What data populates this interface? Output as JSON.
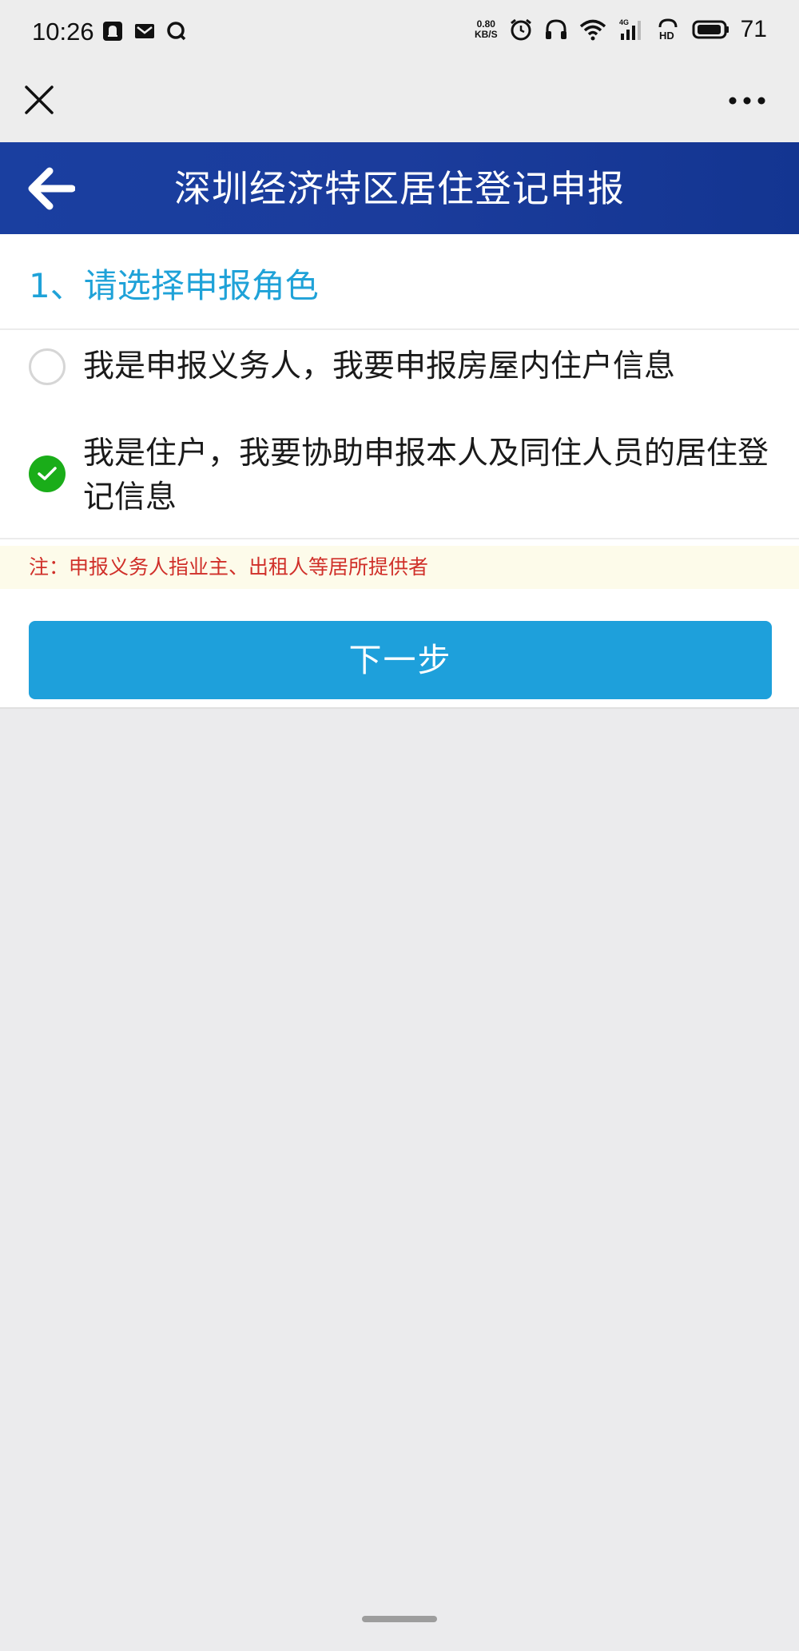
{
  "status_bar": {
    "time": "10:26",
    "speed_value": "0.80",
    "speed_unit": "KB/S",
    "network": "4G",
    "hd": "HD",
    "battery": "71"
  },
  "header": {
    "title": "深圳经济特区居住登记申报"
  },
  "form": {
    "section_title": "1、请选择申报角色",
    "options": [
      {
        "label": "我是申报义务人，我要申报房屋内住户信息",
        "checked": false
      },
      {
        "label": "我是住户，我要协助申报本人及同住人员的居住登记信息",
        "checked": true
      }
    ],
    "note": "注：申报义务人指业主、出租人等居所提供者",
    "next_button": "下一步"
  },
  "colors": {
    "header_bg": "#1b3c9c",
    "accent": "#1fa2d8",
    "button_bg": "#1ea0db",
    "check_green": "#1aad19",
    "note_text": "#d0302a"
  }
}
